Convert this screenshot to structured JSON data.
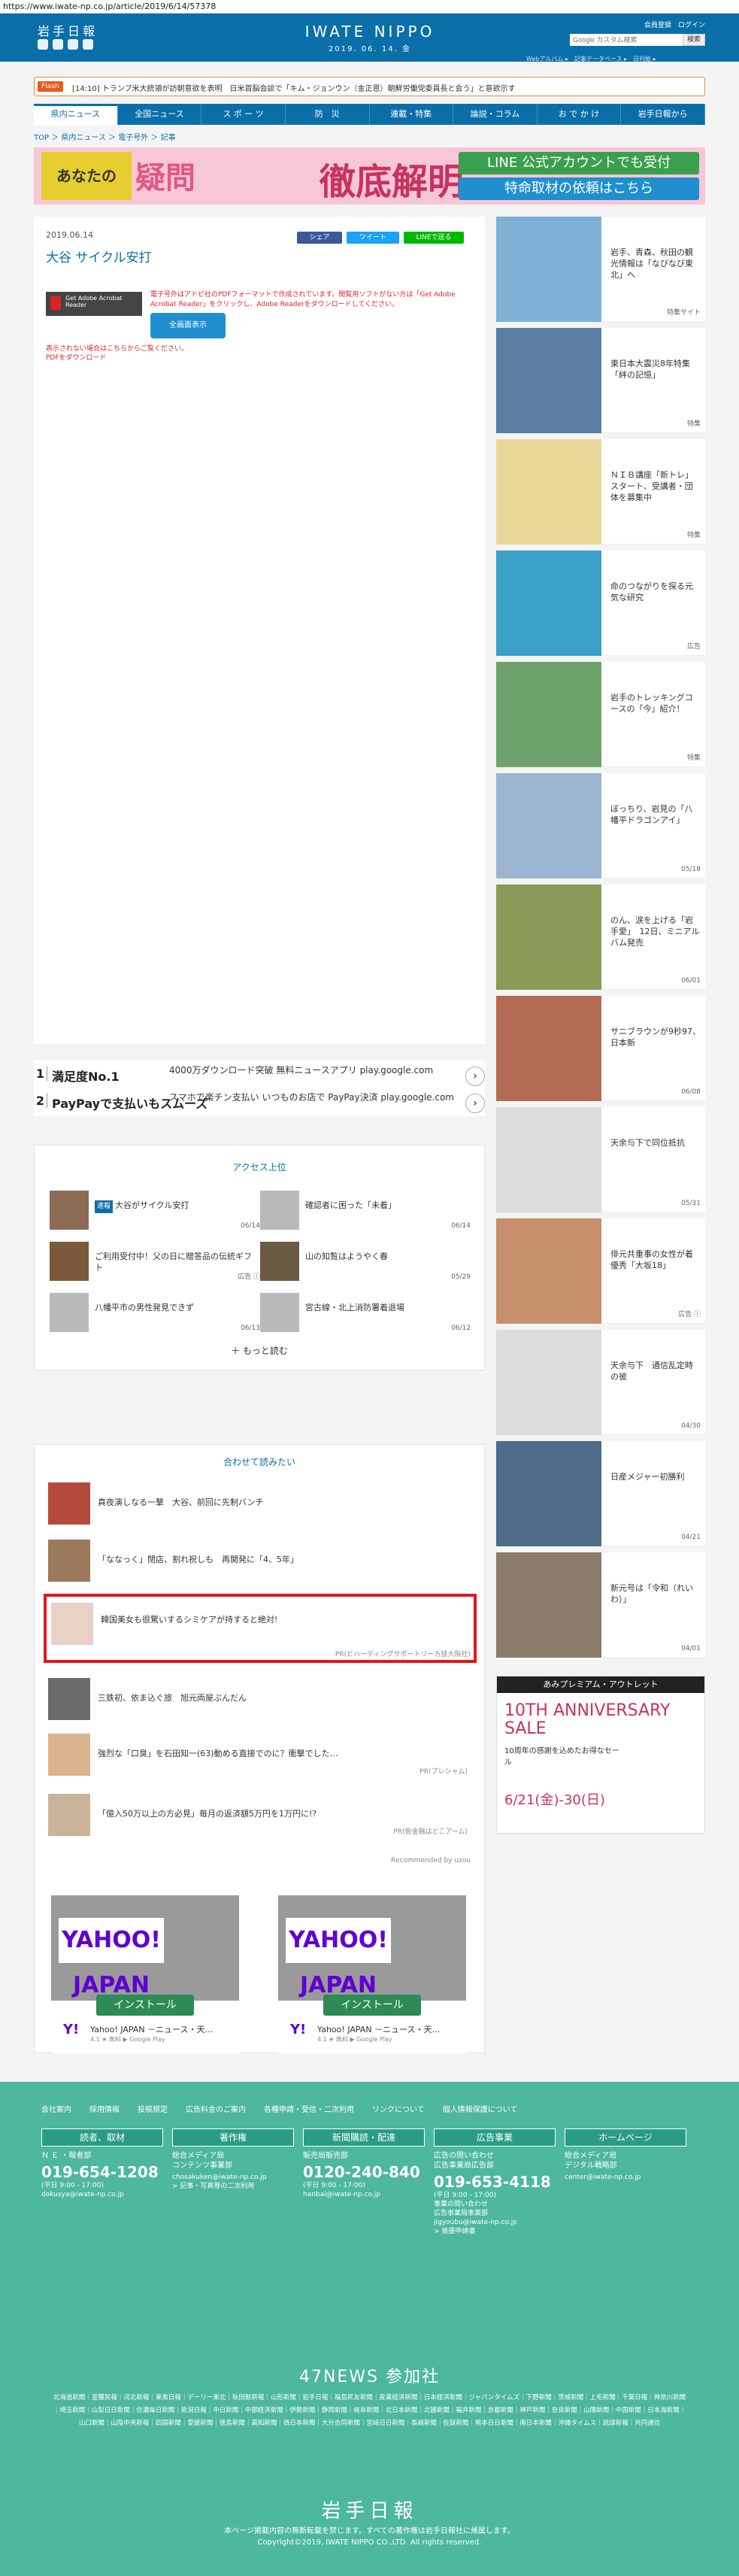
{
  "url": "https://www.iwate-np.co.jp/article/2019/6/14/57378",
  "header": {
    "logo": "岩手日報",
    "brand": "IWATE NIPPO",
    "date": "2019. 06. 14. 金",
    "links": "会員登録　ログイン",
    "search_placeholder": "Google カスタム検索",
    "search_btn": "検索",
    "sub_links": "Webアルバム ▸　記事データベース ▸　日刊紙 ▸"
  },
  "flash": {
    "label": "Flash",
    "text": "[14:10] トランプ米大統領が訪朝意欲を表明　日米首脳会談で「キム・ジョンウン（金正恩）朝鮮労働党委員長と会う」と意欲示す"
  },
  "nav": [
    "県内ニュース",
    "全国ニュース",
    "ス ポ ー ツ",
    "防　災",
    "連載・特集",
    "論説・コラム",
    "お で か け",
    "岩手日報から"
  ],
  "breadcrumb": "TOP ＞ 県内ニュース ＞ 電子号外 ＞ 記事",
  "banner": {
    "a": "あなたの",
    "b": "疑問",
    "c": "徹底解明",
    "d": "LINE 公式アカウントでも受付",
    "e": "特命取材の依頼はこちら"
  },
  "article": {
    "date": "2019.06.14",
    "title": "大谷 サイクル安打",
    "share": [
      "シェア",
      "ツイート",
      "LINEで送る"
    ],
    "pdf_logo": "Get Adobe Acrobat Reader",
    "pdf_text": "電子号外はアドビ社のPDFフォーマットで作成されています。閲覧用ソフトがない方は「Get Adobe Acrobat Reader」をクリックし、Adobe Readerをダウンロードしてください。",
    "pdf_btn": "全画面表示",
    "pdf_dl": "表示されない場合はこちらからご覧ください。\nPDFをダウンロード"
  },
  "ads": [
    {
      "n": "1",
      "h": "満足度No.1",
      "s": "4000万ダウンロード突破 無料ニュースアプリ play.google.com"
    },
    {
      "n": "2",
      "h": "PayPayで支払いもスムーズ",
      "s": "スマホで楽チン支払い いつものお店で PayPay決済 play.google.com"
    }
  ],
  "ranking": {
    "title": "アクセス上位",
    "items": [
      {
        "badge": "速報",
        "t": "大谷がサイクル安打",
        "d": "06/14"
      },
      {
        "t": "確認者に困った「未着」",
        "d": "06/14"
      },
      {
        "t": "ご利用受付中！父の日に贈答品の伝統ギフト",
        "d": "広告 ⓘ"
      },
      {
        "t": "山の知覧はようやく春",
        "d": "05/29"
      },
      {
        "t": "八幡平市の男性発見できず",
        "d": "06/13"
      },
      {
        "t": "宮古線・北上消防署着退場",
        "d": "06/12"
      }
    ],
    "more": "＋ もっと読む"
  },
  "related": {
    "title": "合わせて読みたい",
    "items": [
      {
        "t": "真夜演しなる一撃　大谷、前回に先制バンチ"
      },
      {
        "t": "「ななっく」閉店、割れ祝しも　再開発に「4、5年」"
      },
      {
        "t": "韓国美女も很驚いするシミケアが持すると絶対!",
        "pr": "PR(ビハーディングサポートリー方技大阪社)"
      },
      {
        "t": "三鉄初、依ま込ぐ旅　旭元両屋ぶんだん"
      },
      {
        "t": "強烈な「口臭」を石田知一(63)動める直接でのに？衝撃でした…",
        "pr": "PR(プレシャム)"
      },
      {
        "t": "「億入50万以上の方必見」毎月の返済額5万円を1万円に!?",
        "pr": "PR(街金融はどこアーム)"
      }
    ],
    "recom": "Recommended by uzou"
  },
  "yahoo": [
    {
      "logo": "YAHOO! JAPAN",
      "btn": "インストール",
      "name": "Yahoo! JAPAN －ニュース・天…",
      "rating": "4.1 ★ 無料 ▶ Google Play"
    },
    {
      "logo": "YAHOO! JAPAN",
      "btn": "インストール",
      "name": "Yahoo! JAPAN －ニュース・天…",
      "rating": "4.1 ★ 無料 ▶ Google Play"
    }
  ],
  "sidebar": [
    {
      "t": "岩手、青森、秋田の観光情報は「なびなび東北」へ",
      "d": "特集サイト",
      "c": "#7fb1d6"
    },
    {
      "t": "東日本大震災8年特集「絆の記憶」",
      "d": "特集",
      "c": "#5b7fa3"
    },
    {
      "t": "ＮＩＢ講座「新トレ」スタート、受講者・団体を募集中",
      "d": "特集",
      "c": "#e9d79a"
    },
    {
      "t": "命のつながりを探る元気な研究",
      "d": "広告",
      "c": "#3aa0c8"
    },
    {
      "t": "岩手のトレッキングコースの「今」紹介！",
      "d": "特集",
      "c": "#6ea36b"
    },
    {
      "t": "ぼっちり、岩見の「八幡平ドラゴンアイ」",
      "d": "05/18",
      "c": "#9bb6cf"
    },
    {
      "t": "のん、涙を上げる「岩手愛」　12日、ミニアルバム発売",
      "d": "06/01",
      "c": "#8a9a57"
    },
    {
      "t": "サニブラウンが9秒97、日本新",
      "d": "06/08",
      "c": "#b46b54"
    },
    {
      "t": "天余与下で同位抵抗",
      "d": "05/31",
      "c": "#dcdcdc"
    },
    {
      "t": "俳元共重事の女性が着優秀「大坂18」",
      "d": "広告 ⓘ",
      "c": "#c78f6b"
    },
    {
      "t": "天余与下　通信乱定時の彼",
      "d": "04/30",
      "c": "#dcdcdc"
    },
    {
      "t": "日産メジャー初勝利",
      "d": "04/21",
      "c": "#4d6c8a"
    },
    {
      "t": "新元号は「令和（れいわ）」",
      "d": "04/01",
      "c": "#8a7a6a"
    }
  ],
  "side_ad": {
    "t1": "あみプレミアム・アウトレット",
    "t2": "10TH ANNIVERSARY SALE",
    "t3": "10周年の感謝を込めたお得なセール",
    "t4": "6/21(金)-30(日)"
  },
  "footer": {
    "links": [
      "会社案内",
      "採用情報",
      "投稿規定",
      "広告料金のご案内",
      "各種申請・受信・二次利用",
      "リンクについて",
      "個人情報保護について"
    ],
    "cols": [
      {
        "h": "読者、取材",
        "l": "Ｎ Ｅ ・報者部",
        "p": "019-654-1208",
        "s": "(平日 9:00 - 17:00)\ndokusya@iwate-np.co.jp"
      },
      {
        "h": "著作権",
        "l": "総合メディア局\nコンテンツ事業部",
        "p": "",
        "s": "chosakuken@iwate-np.co.jp\n> 記事・写真等の二次利用"
      },
      {
        "h": "新聞購読・配達",
        "l": "販売局販売部",
        "p": "0120-240-840",
        "s": "(平日 9:00 - 17:00)\nhanbai@iwate-np.co.jp"
      },
      {
        "h": "広告事業",
        "l": "広告の問い合わせ\n広告事業局広告部",
        "p": "019-653-4118",
        "s": "(平日 9:00 - 17:00)\n事業の問い合わせ\n広告事業局事業部\njigyoubu@iwate-np.co.jp\n> 後援申請書"
      },
      {
        "h": "ホームページ",
        "l": "総合メディア局\nデジタル戦略部",
        "p": "",
        "s": "center@iwate-np.co.jp"
      }
    ],
    "news": "47NEWS 参加社",
    "newsl": "北海道新聞｜室蘭民報｜河北新報｜東奥日報｜デーリー東北｜秋田魁新報｜山形新聞｜岩手日報｜福島民友新聞｜産業経済新聞｜日本経済新聞｜ジャパンタイムズ｜下野新聞｜茨城新聞｜上毛新聞｜千葉日報｜神奈川新聞｜埼玉新聞｜山梨日日新聞｜信濃毎日新聞｜新潟日報｜中日新聞｜中部経済新聞｜伊勢新聞｜静岡新聞｜岐阜新聞｜北日本新聞｜北國新聞｜福井新聞｜京都新聞｜神戸新聞｜奈良新聞｜山陽新聞｜中国新聞｜日本海新聞｜山口新聞｜山陰中央新報｜四国新聞｜愛媛新聞｜徳島新聞｜高知新聞｜西日本新聞｜大分合同新聞｜宮崎日日新聞｜長崎新聞｜佐賀新聞｜熊本日日新聞｜南日本新聞｜沖縄タイムス｜琉球新報｜共同通信",
    "brand": "岩手日報",
    "copy": "本ページ掲載内容の無断転載を禁じます。すべての著作権は岩手日報社に帰属します。\nCopyright©2019, IWATE NIPPO CO.,LTD. All rights reserved."
  }
}
